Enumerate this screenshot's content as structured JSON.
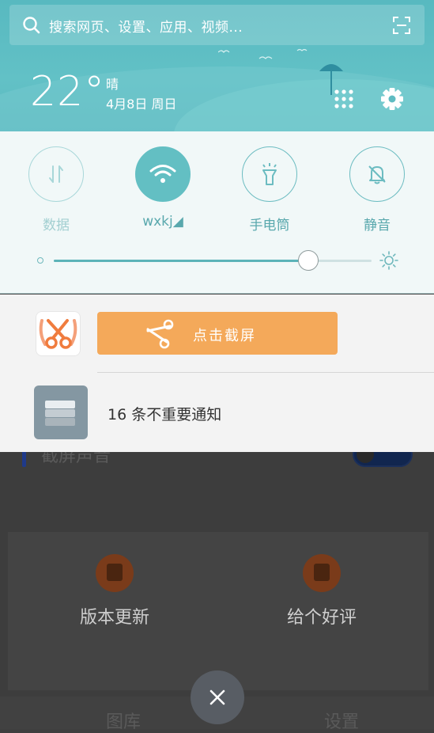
{
  "search": {
    "placeholder": "搜索网页、设置、应用、视频..."
  },
  "weather": {
    "temperature": "22°",
    "condition": "晴",
    "date": "4月8日 周日"
  },
  "toggles": [
    {
      "label": "数据",
      "state": "off"
    },
    {
      "label": "wxkj◢",
      "state": "on"
    },
    {
      "label": "手电筒",
      "state": "off"
    },
    {
      "label": "静音",
      "state": "off"
    }
  ],
  "brightness": {
    "level": 0.8
  },
  "notifications": {
    "screenshot_button": "点击截屏",
    "unimportant": "16 条不重要通知"
  },
  "background_app": {
    "strip_text": "截屏声音",
    "cells": [
      "版本更新",
      "给个好评"
    ],
    "footer": [
      "图库",
      "设置"
    ]
  },
  "colors": {
    "accent": "#62bfc4",
    "orange": "#f4a95a"
  }
}
